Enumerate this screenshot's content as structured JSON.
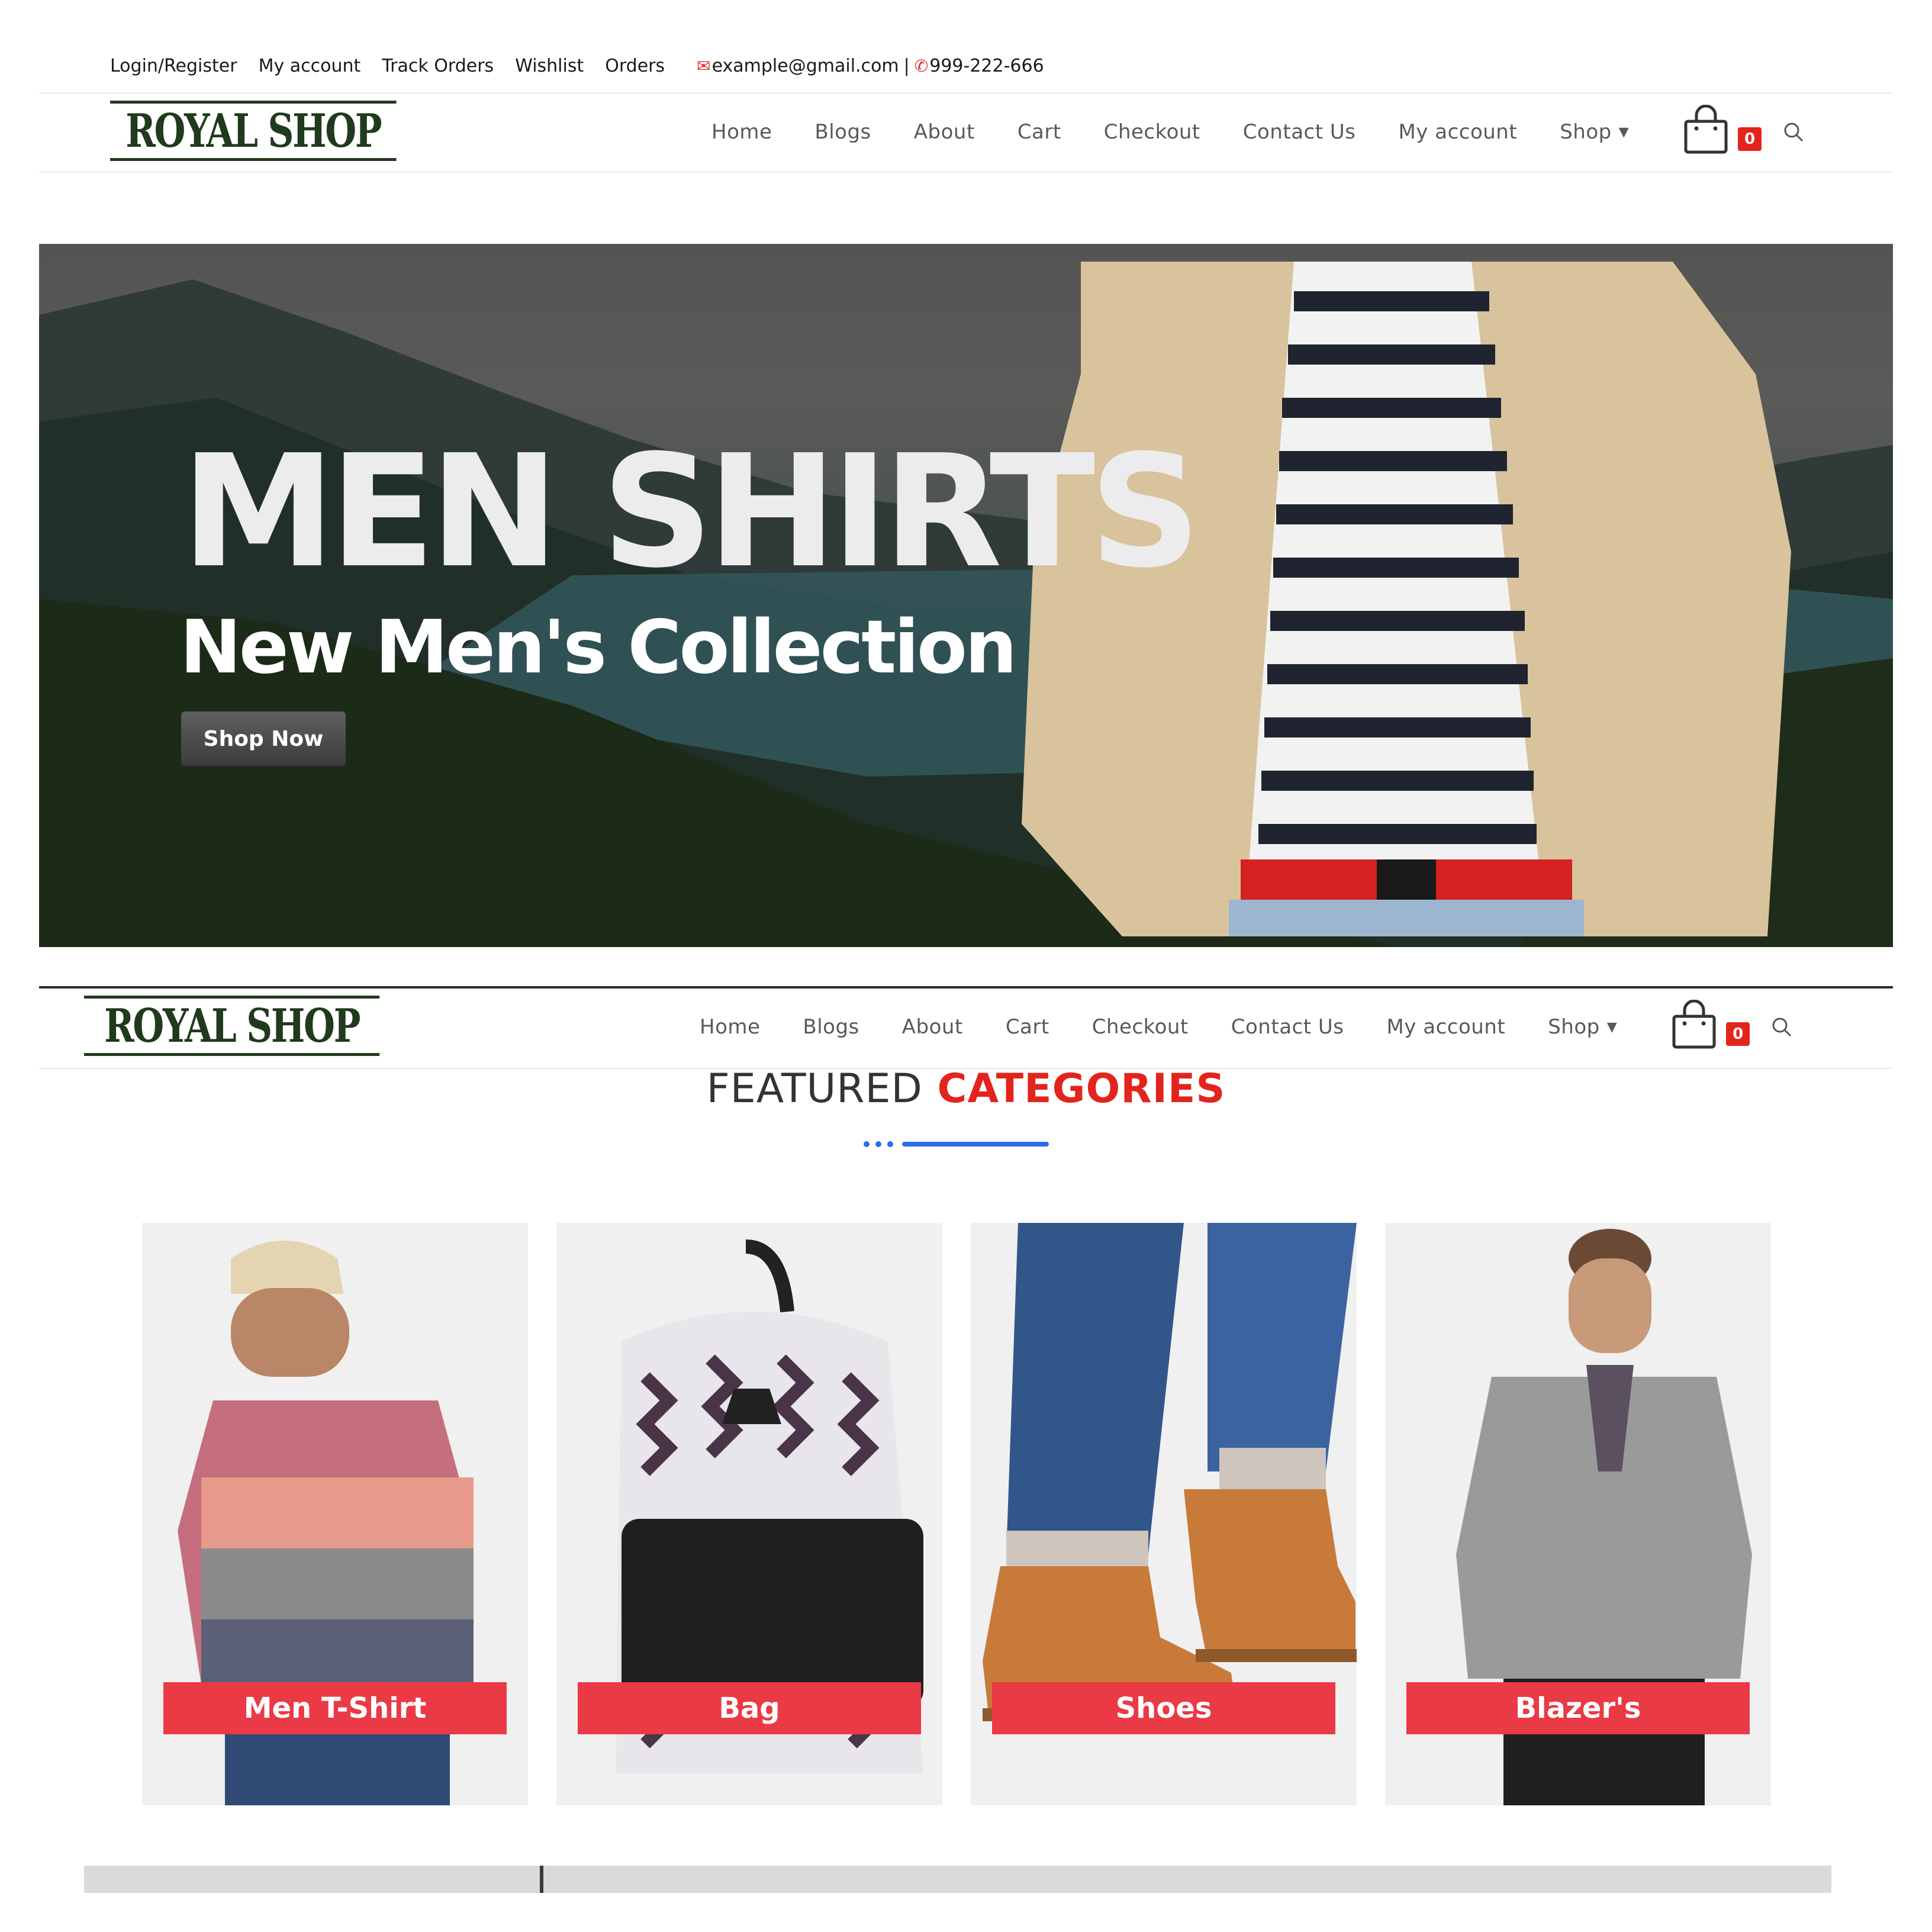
{
  "topbar": {
    "links": [
      "Login/Register",
      "My account",
      "Track Orders",
      "Wishlist",
      "Orders"
    ],
    "email": "example@gmail.com",
    "separator": "|",
    "phone": "999-222-666"
  },
  "brand": {
    "logo_text": "ROYAL SHOP"
  },
  "nav": {
    "items": [
      "Home",
      "Blogs",
      "About",
      "Cart",
      "Checkout",
      "Contact Us",
      "My account",
      "Shop"
    ],
    "cart_count": "0"
  },
  "hero": {
    "title": "MEN SHIRTS",
    "subtitle": "New Men's Collection",
    "cta": "Shop Now"
  },
  "featured": {
    "title_part1": "FEATURED",
    "title_part2": "CATEGORIES",
    "categories": [
      {
        "label": "Men T-Shirt"
      },
      {
        "label": "Bag"
      },
      {
        "label": "Shoes"
      },
      {
        "label": "Blazer's"
      }
    ]
  },
  "icons": {
    "mail": "mail-icon",
    "phone": "phone-icon",
    "cart": "shopping-bag-icon",
    "search": "search-icon",
    "chevron": "chevron-down-icon"
  },
  "colors": {
    "accent_red": "#e3241d",
    "category_label": "#ea3a46",
    "logo_green": "#1f3a1c",
    "divider_blue": "#2a6ee8"
  }
}
